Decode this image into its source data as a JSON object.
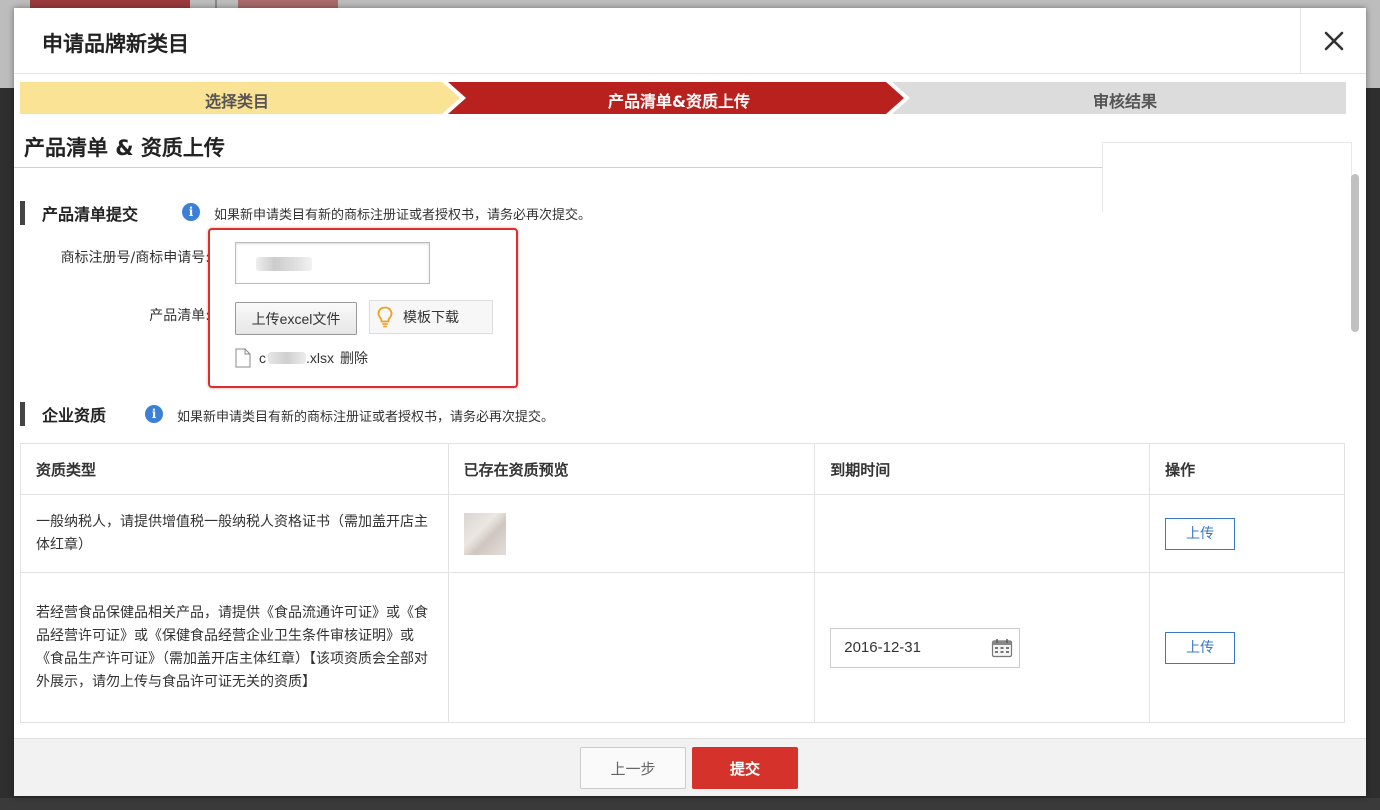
{
  "dialog": {
    "title": "申请品牌新类目",
    "close_label": "×"
  },
  "steps": [
    {
      "label": "选择类目",
      "color": "#fbe395"
    },
    {
      "label": "产品清单&资质上传",
      "color": "#b8211e"
    },
    {
      "label": "审核结果",
      "color": "#dcdcdc"
    }
  ],
  "section": {
    "title": "产品清单 & 资质上传"
  },
  "product_list": {
    "heading": "产品清单提交",
    "hint": "如果新申请类目有新的商标注册证或者授权书，请务必再次提交。",
    "trademark_label": "商标注册号/商标申请号:",
    "list_label": "产品清单:",
    "upload_excel_label": "上传excel文件",
    "template_label": "模板下载",
    "file_suffix": ".xlsx",
    "file_prefix": "c",
    "delete_label": "删除"
  },
  "enterprise": {
    "heading": "企业资质",
    "hint": "如果新申请类目有新的商标注册证或者授权书，请务必再次提交。"
  },
  "table": {
    "headers": [
      "资质类型",
      "已存在资质预览",
      "到期时间",
      "操作"
    ],
    "rows": [
      {
        "type": "一般纳税人，请提供增值税一般纳税人资格证书（需加盖开店主体红章）",
        "expiry": "",
        "action": "上传"
      },
      {
        "type": "若经营食品保健品相关产品，请提供《食品流通许可证》或《食品经营许可证》或《保健食品经营企业卫生条件审核证明》或《食品生产许可证》（需加盖开店主体红章）【该项资质会全部对外展示，请勿上传与食品许可证无关的资质】",
        "expiry": "2016-12-31",
        "action": "上传"
      }
    ]
  },
  "footer": {
    "prev_label": "上一步",
    "submit_label": "提交"
  },
  "colors": {
    "accent": "#d5322c",
    "link_blue": "#3a78c8",
    "info_blue": "#3c7fd8"
  }
}
